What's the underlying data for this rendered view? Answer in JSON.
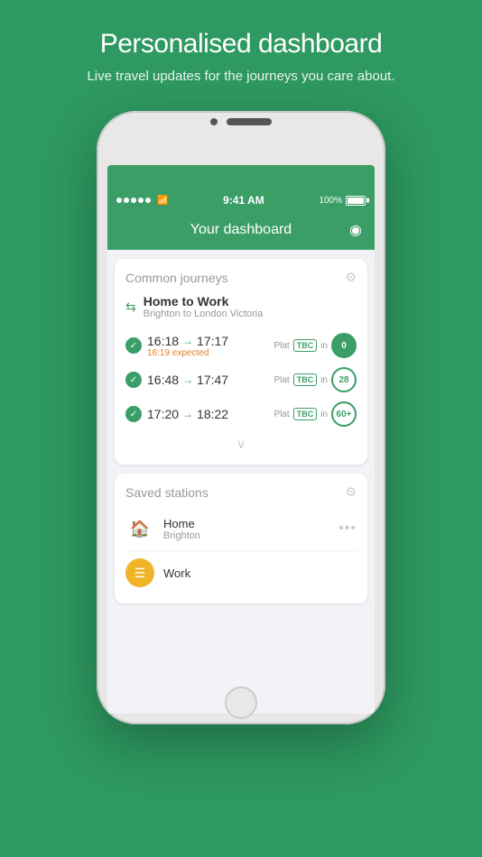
{
  "page": {
    "bg_color": "#2e9960",
    "header": {
      "title": "Personalised dashboard",
      "subtitle": "Live travel updates for the journeys you care about."
    }
  },
  "status_bar": {
    "time": "9:41 AM",
    "battery": "100%"
  },
  "app_header": {
    "title": "Your dashboard",
    "eye_icon": "👁"
  },
  "journeys_card": {
    "section_title": "Common journeys",
    "journey_name": "Home to Work",
    "journey_subtitle": "Brighton to London Victoria",
    "trains": [
      {
        "depart": "16:18",
        "arrive": "17:17",
        "delayed": "16:19 expected",
        "platform": "TBC",
        "minutes": "0",
        "is_now": true
      },
      {
        "depart": "16:48",
        "arrive": "17:47",
        "delayed": "",
        "platform": "TBC",
        "minutes": "28",
        "is_now": false
      },
      {
        "depart": "17:20",
        "arrive": "18:22",
        "delayed": "",
        "platform": "TBC",
        "minutes": "60+",
        "is_now": false
      }
    ]
  },
  "stations_card": {
    "section_title": "Saved stations",
    "stations": [
      {
        "name": "Home",
        "place": "Brighton",
        "icon_type": "home"
      },
      {
        "name": "Work",
        "place": "",
        "icon_type": "work_circle"
      }
    ]
  },
  "labels": {
    "plat": "Plat",
    "in": "in",
    "tbc": "TBC",
    "show_more": "∨"
  }
}
